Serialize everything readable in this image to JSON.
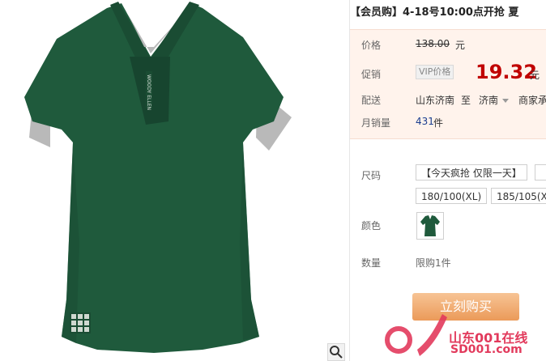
{
  "product": {
    "title": "【会员购】4-18号10:00点开抢 夏",
    "shirt_brand_text": "WOODY ELLEN",
    "colors": {
      "shirt": "#1f5a3c",
      "trim": "#b9b9b9",
      "price_red": "#c00000",
      "link_blue": "#1a3d8f",
      "buy_orange": "#eb9a59"
    }
  },
  "price": {
    "list_label": "价格",
    "list_value": "138.00",
    "list_unit": "元",
    "promo_label": "促销",
    "vip_tag": "VIP价格",
    "promo_value": "19.32",
    "promo_unit": "元"
  },
  "delivery": {
    "label": "配送",
    "from": "山东济南",
    "to_word": "至",
    "dest": "济南",
    "extra": "商家承"
  },
  "sales": {
    "label": "月销量",
    "count": "431",
    "unit": "件"
  },
  "options": {
    "size_label": "尺码",
    "sizes": [
      "【今天疯抢 仅限一天】",
      "",
      "180/100(XL)",
      "185/105(X"
    ],
    "color_label": "颜色",
    "quantity_label": "数量",
    "quantity_note": "限购1件"
  },
  "actions": {
    "buy_label": "立刻购买"
  },
  "watermark": {
    "line1": "山东001在线",
    "line2": "SD001.com"
  }
}
